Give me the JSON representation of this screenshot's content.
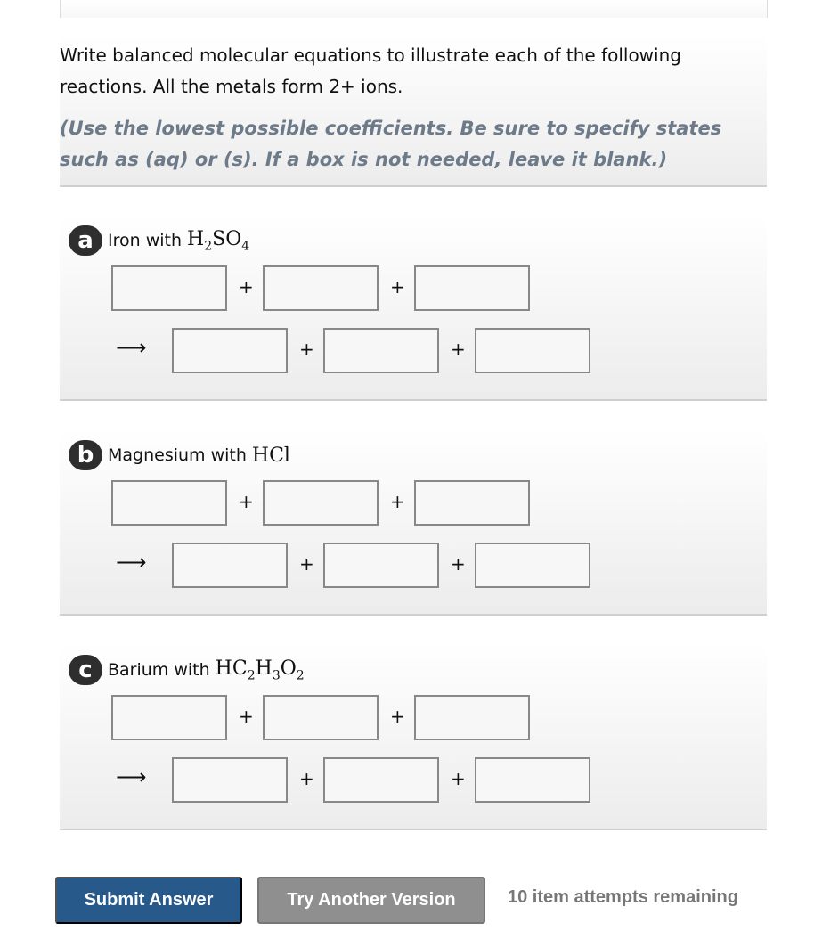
{
  "instructions": {
    "main": "Write balanced molecular equations to illustrate each of the following reactions. All the metals form 2+ ions.",
    "hint": "(Use the lowest possible coefficients. Be sure to specify states such as (aq) or (s). If a box is not needed, leave it blank.)"
  },
  "parts": [
    {
      "badge": "a",
      "text": "Iron with",
      "formula": [
        [
          "H",
          "2"
        ],
        [
          "SO",
          "4"
        ]
      ]
    },
    {
      "badge": "b",
      "text": "Magnesium with",
      "formula": [
        [
          "HCl",
          ""
        ]
      ]
    },
    {
      "badge": "c",
      "text": "Barium with",
      "formula": [
        [
          "HC",
          "2"
        ],
        [
          "H",
          "3"
        ],
        [
          "O",
          "2"
        ]
      ]
    }
  ],
  "symbols": {
    "plus": "+",
    "arrow": "⟶"
  },
  "buttons": {
    "submit": "Submit Answer",
    "try_another": "Try Another Version"
  },
  "attempts_text": "10 item attempts remaining"
}
